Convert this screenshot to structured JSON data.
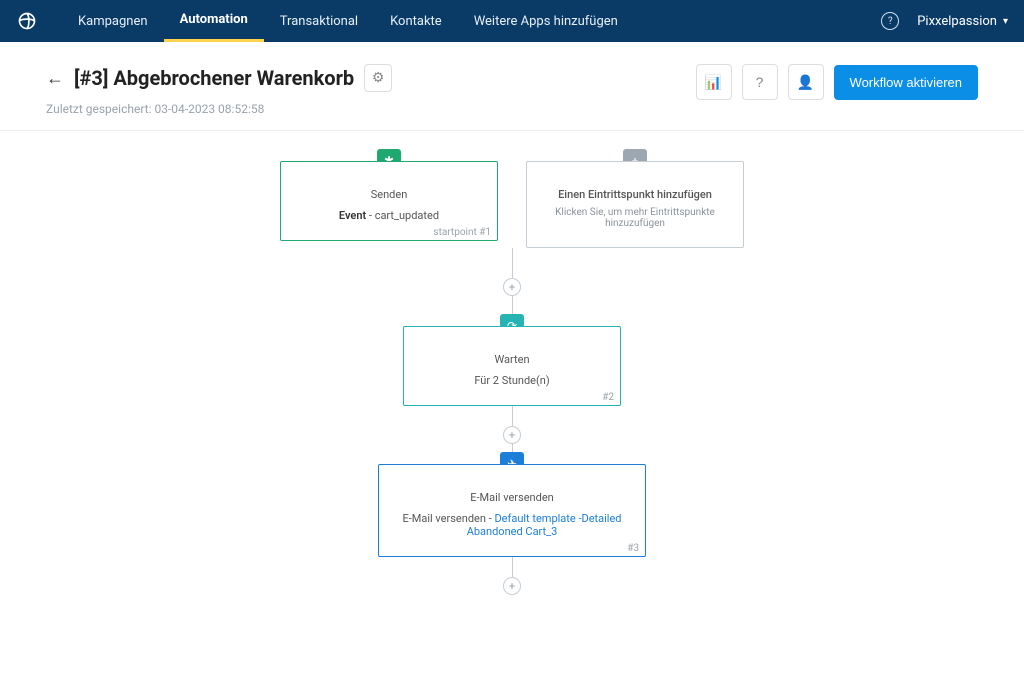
{
  "nav": {
    "items": [
      "Kampagnen",
      "Automation",
      "Transaktional",
      "Kontakte",
      "Weitere Apps hinzufügen"
    ],
    "active_index": 1,
    "user": "Pixxelpassion"
  },
  "header": {
    "title": "[#3] Abgebrochener Warenkorb",
    "saved": "Zuletzt gespeichert: 03-04-2023 08:52:58",
    "activate": "Workflow aktivieren"
  },
  "nodes": {
    "entry": {
      "title": "Senden",
      "type_label": "Event",
      "type_detail": "cart_updated",
      "id": "startpoint #1"
    },
    "add_entry": {
      "title": "Einen Eintrittspunkt hinzufügen",
      "desc": "Klicken Sie, um mehr Eintrittspunkte hinzuzufügen"
    },
    "wait": {
      "title": "Warten",
      "desc": "Für 2 Stunde(n)",
      "id": "#2"
    },
    "send": {
      "title": "E-Mail versenden",
      "prefix": "E-Mail versenden - ",
      "template": "Default template -Detailed Abandoned Cart_3",
      "id": "#3"
    }
  }
}
